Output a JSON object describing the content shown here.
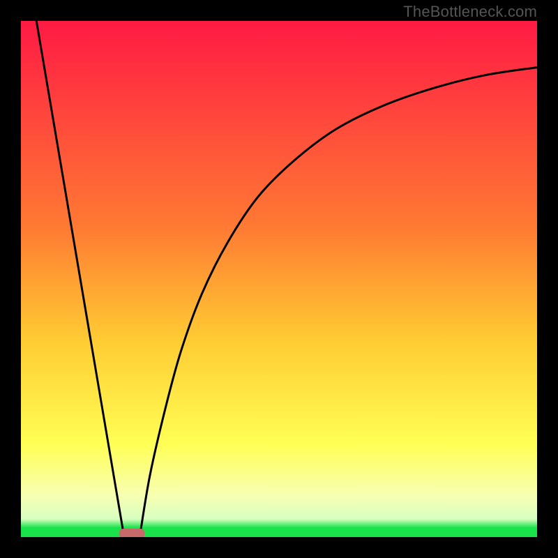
{
  "watermark": "TheBottleneck.com",
  "colors": {
    "top": "#ff1a44",
    "mid_upper": "#ff7a33",
    "mid": "#ffcc33",
    "mid_lower": "#ffff55",
    "pale": "#f7ffb3",
    "green": "#19e24b",
    "black": "#000000",
    "curve": "#000000",
    "marker": "#c96a6a"
  },
  "chart_data": {
    "type": "line",
    "title": "",
    "xlabel": "",
    "ylabel": "",
    "xlim": [
      0,
      100
    ],
    "ylim": [
      0,
      100
    ],
    "series": [
      {
        "name": "left-line",
        "x": [
          3,
          20
        ],
        "y": [
          100,
          0
        ]
      },
      {
        "name": "right-curve",
        "x": [
          23,
          25,
          28,
          31,
          35,
          40,
          46,
          53,
          61,
          70,
          80,
          90,
          100
        ],
        "y": [
          0,
          12,
          25,
          36,
          47,
          57,
          66,
          73,
          79,
          83.5,
          87,
          89.5,
          91
        ]
      }
    ],
    "marker": {
      "x_start": 19,
      "x_end": 24,
      "y": 0
    },
    "gradient_bands_y": [
      0,
      2.5,
      5.5,
      9,
      60,
      100
    ]
  }
}
